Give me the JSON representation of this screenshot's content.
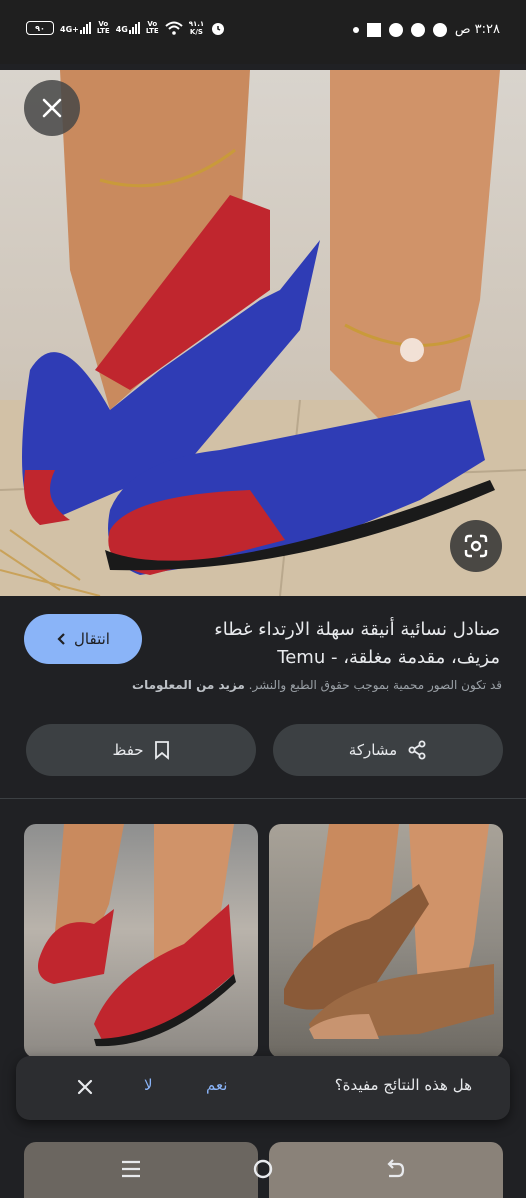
{
  "status_bar": {
    "battery": "٩٠",
    "net1": "4G+",
    "net2": "4G",
    "volte": "Vo\nLTE",
    "speed": "٩١.١\nK/S",
    "time": "٣:٢٨ ص"
  },
  "result": {
    "title": "صنادل نسائية أنيقة سهلة الارتداء غطاء مزيف، مقدمة مغلقة، - Temu",
    "visit_label": "انتقال",
    "copyright_text": "قد تكون الصور محمية بموجب حقوق الطبع والنشر.",
    "more_info_label": "مزيد من المعلومات",
    "share_label": "مشاركة",
    "save_label": "حفظ"
  },
  "feedback": {
    "question": "هل هذه النتائج مفيدة؟",
    "yes": "نعم",
    "no": "لا"
  },
  "colors": {
    "accent": "#8ab4f8",
    "background": "#202124",
    "button_bg": "#3c4043"
  },
  "icons": [
    "close-icon",
    "google-lens-icon",
    "chevron-left-icon",
    "share-icon",
    "bookmark-icon",
    "menu-icon",
    "home-icon",
    "back-icon"
  ]
}
